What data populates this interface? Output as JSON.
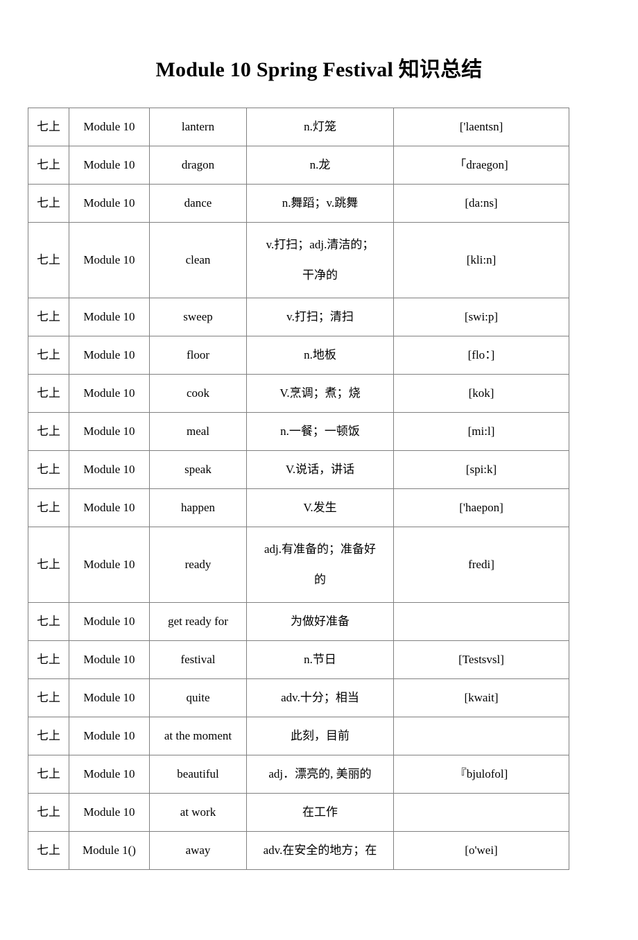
{
  "document": {
    "title": "Module 10 Spring Festival 知识总结"
  },
  "table": {
    "name": "vocabulary-table",
    "columns": [
      "grade",
      "module",
      "word",
      "meaning",
      "phonetic"
    ],
    "rows": [
      {
        "grade": "七上",
        "module": "Module 10",
        "word": "lantern",
        "meaning": "n.灯笼",
        "phonetic": "['laentsn]",
        "tall": false
      },
      {
        "grade": "七上",
        "module": "Module 10",
        "word": "dragon",
        "meaning": "n.龙",
        "phonetic": "「draegon]",
        "tall": false
      },
      {
        "grade": "七上",
        "module": "Module 10",
        "word": "dance",
        "meaning": "n.舞蹈；v.跳舞",
        "phonetic": "[da:ns]",
        "tall": false
      },
      {
        "grade": "七上",
        "module": "Module 10",
        "word": "clean",
        "meaning": "v.打扫；adj.清洁的；\n干净的",
        "phonetic": "[kli:n]",
        "tall": true
      },
      {
        "grade": "七上",
        "module": "Module 10",
        "word": "sweep",
        "meaning": "v.打扫；清扫",
        "phonetic": "[swi:p]",
        "tall": false
      },
      {
        "grade": "七上",
        "module": "Module 10",
        "word": "floor",
        "meaning": "n.地板",
        "phonetic": "[flo：]",
        "tall": false
      },
      {
        "grade": "七上",
        "module": "Module 10",
        "word": "cook",
        "meaning": "V.烹调；煮；烧",
        "phonetic": "[kok]",
        "tall": false
      },
      {
        "grade": "七上",
        "module": "Module 10",
        "word": "meal",
        "meaning": "n.一餐；一顿饭",
        "phonetic": "[mi:l]",
        "tall": false
      },
      {
        "grade": "七上",
        "module": "Module 10",
        "word": "speak",
        "meaning": "V.说话，讲话",
        "phonetic": "[spi:k]",
        "tall": false
      },
      {
        "grade": "七上",
        "module": "Module 10",
        "word": "happen",
        "meaning": "V.发生",
        "phonetic": "['haepon]",
        "tall": false
      },
      {
        "grade": "七上",
        "module": "Module 10",
        "word": "ready",
        "meaning": "adj.有准备的；准备好\n的",
        "phonetic": "fredi]",
        "tall": true
      },
      {
        "grade": "七上",
        "module": "Module 10",
        "word": "get ready for",
        "meaning": "为做好准备",
        "phonetic": "",
        "tall": false
      },
      {
        "grade": "七上",
        "module": "Module 10",
        "word": "festival",
        "meaning": "n.节日",
        "phonetic": "[Testsvsl]",
        "tall": false
      },
      {
        "grade": "七上",
        "module": "Module 10",
        "word": "quite",
        "meaning": "adv.十分；相当",
        "phonetic": "[kwait]",
        "tall": false
      },
      {
        "grade": "七上",
        "module": "Module 10",
        "word": "at the moment",
        "meaning": "此刻，目前",
        "phonetic": "",
        "tall": false
      },
      {
        "grade": "七上",
        "module": "Module 10",
        "word": "beautiful",
        "meaning": "adj．漂亮的, 美丽的",
        "phonetic": "『bjulofol]",
        "tall": false
      },
      {
        "grade": "七上",
        "module": "Module 10",
        "word": "at work",
        "meaning": "在工作",
        "phonetic": "",
        "tall": false
      },
      {
        "grade": "七上",
        "module": "Module 1()",
        "word": "away",
        "meaning": "adv.在安全的地方；在",
        "phonetic": "[o'wei]",
        "tall": false
      }
    ]
  }
}
